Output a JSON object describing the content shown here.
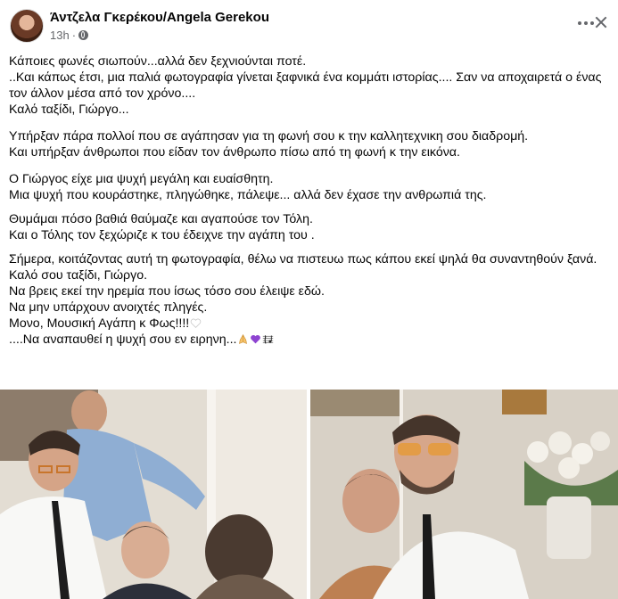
{
  "post": {
    "author": "Άντζελα Γκερέκου/Angela Gerekou",
    "time": "13h",
    "paragraphs": [
      [
        "Κάποιες φωνές σιωπούν...αλλά δεν ξεχνιούνται ποτέ.",
        "..Και κάπως έτσι, μια παλιά φωτογραφία γίνεται ξαφνικά ένα κομμάτι ιστορίας.... Σαν να αποχαιρετά ο ένας τον άλλον μέσα από τον χρόνο....",
        "Καλό ταξίδι, Γιώργο..."
      ],
      [
        "Υπήρξαν  πάρα πολλοί  που σε αγάπησαν για τη φωνή σου κ την καλλητεχνικη σου διαδρομή.",
        "Και υπήρξαν άνθρωποι που είδαν τον άνθρωπο πίσω από τη φωνή κ την εικόνα."
      ],
      [
        "Ο Γιώργος είχε μια ψυχή μεγάλη και ευαίσθητη.",
        "Μια ψυχή που κουράστηκε, πληγώθηκε, πάλεψε... αλλά δεν έχασε την ανθρωπιά της."
      ],
      [
        "Θυμάμαι πόσο βαθιά θαύμαζε και αγαπούσε τον Τόλη.",
        "Και ο Τόλης τον ξεχώριζε κ  του έδειχνε την αγάπη του ."
      ],
      [
        "Σήμερα, κοιτάζοντας αυτή τη φωτογραφία, θέλω να  πιστευω πως κάπου εκεί ψηλά  θα συναντηθούν ξανά.",
        "Καλό σου  ταξίδι, Γιώργο.",
        "Να βρεις εκεί την ηρεμία που ίσως τόσο σου έλειψε εδώ.",
        "Να μην υπάρχουν ανοιχτές πληγές.",
        " Μονο, Μουσική  Αγάπη  κ Φως!!!!",
        "....Να αναπαυθεί η ψυχή σου εν ειρηνη..."
      ]
    ]
  },
  "icons": {
    "privacy": "globe-icon",
    "heart": "white-heart-emoji",
    "pray": "praying-hands-emoji",
    "purple_heart": "purple-heart-emoji",
    "music": "musical-score-emoji"
  },
  "colors": {
    "author": "#050505",
    "meta": "#65676b",
    "text": "#050505"
  }
}
